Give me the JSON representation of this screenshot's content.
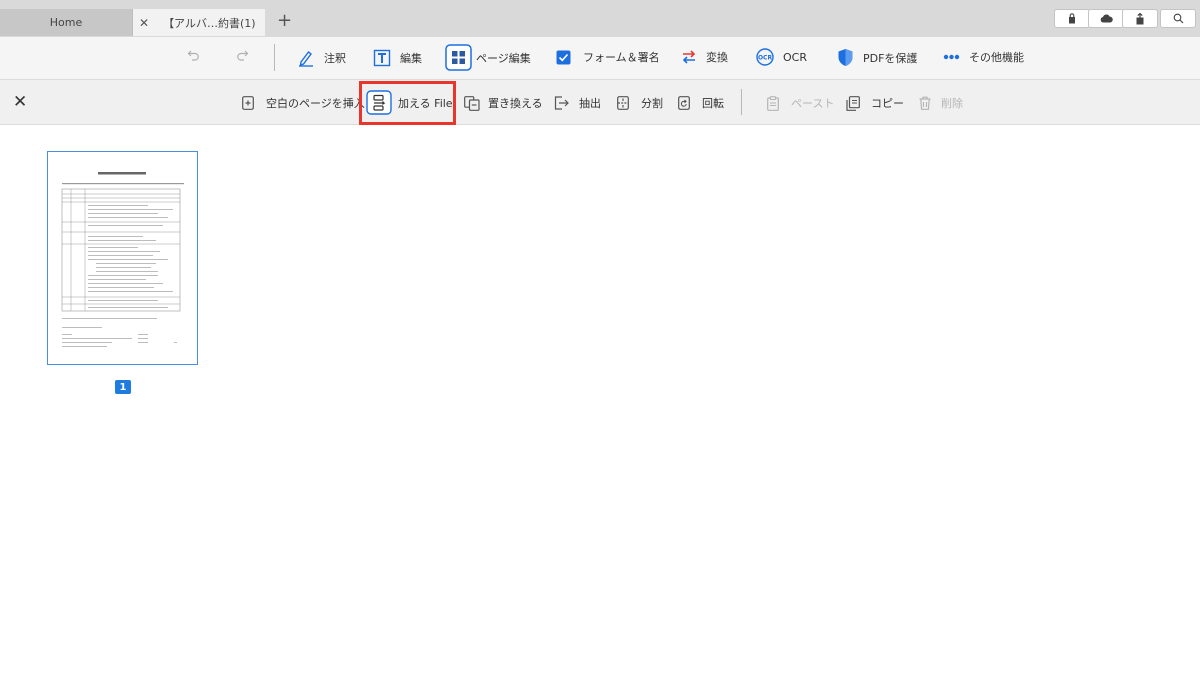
{
  "tabs": [
    {
      "label": "Home"
    },
    {
      "label": "【アルバ…約書(1)",
      "close": "✕"
    }
  ],
  "new_tab": "+",
  "top_right_icons": [
    "lock-icon",
    "cloud-icon",
    "share-icon",
    "search-icon"
  ],
  "main_toolbar": {
    "items": [
      {
        "label": "注釈",
        "icon": "pen-icon"
      },
      {
        "label": "編集",
        "icon": "text-edit-icon"
      },
      {
        "label": "ページ編集",
        "icon": "page-grid-icon"
      },
      {
        "label": "フォーム＆署名",
        "icon": "checkbox-icon"
      },
      {
        "label": "変換",
        "icon": "convert-icon"
      },
      {
        "label": "OCR",
        "icon": "ocr-icon"
      },
      {
        "label": "PDFを保護",
        "icon": "shield-icon"
      },
      {
        "label": "その他機能",
        "icon": "more-icon"
      }
    ]
  },
  "page_toolbar": {
    "close": "✕",
    "items": [
      {
        "label": "空白のページを挿入",
        "icon": "insert-blank-icon"
      },
      {
        "label": "加える File",
        "icon": "add-file-icon"
      },
      {
        "label": "置き換える",
        "icon": "replace-icon"
      },
      {
        "label": "抽出",
        "icon": "extract-icon"
      },
      {
        "label": "分割",
        "icon": "split-icon"
      },
      {
        "label": "回転",
        "icon": "rotate-icon"
      },
      {
        "label": "ペースト",
        "icon": "paste-icon"
      },
      {
        "label": "コピー",
        "icon": "copy-icon"
      },
      {
        "label": "削除",
        "icon": "delete-icon"
      }
    ]
  },
  "pages": [
    {
      "number": "1"
    }
  ],
  "colors": {
    "accent": "#1e7be0",
    "highlight": "#e8362c",
    "shield": "#1d6fe0",
    "convert": "#e53935"
  }
}
